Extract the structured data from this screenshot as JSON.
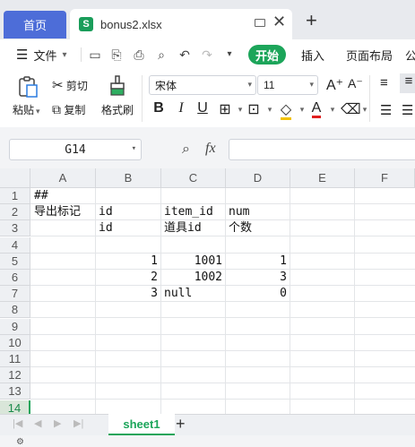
{
  "titlebar": {
    "home_tab": "首页",
    "file_tab": "bonus2.xlsx",
    "file_icon": "S",
    "new_tab": "+"
  },
  "menubar": {
    "file_menu": "文件",
    "start_tab": "开始",
    "insert_tab": "插入",
    "layout_tab": "页面布局",
    "more_tab": "公"
  },
  "ribbon": {
    "paste": "粘贴",
    "cut": "剪切",
    "copy": "复制",
    "format_painter": "格式刷",
    "font_name": "宋体",
    "font_size": "11"
  },
  "formula": {
    "cell_ref": "G14",
    "fx": "fx",
    "content": ""
  },
  "columns": [
    "A",
    "B",
    "C",
    "D",
    "E",
    "F"
  ],
  "rows": [
    "1",
    "2",
    "3",
    "4",
    "5",
    "6",
    "7",
    "8",
    "9",
    "10",
    "11",
    "12",
    "13",
    "14"
  ],
  "selected_row": "14",
  "cells": {
    "A1": "##",
    "A2": "导出标记",
    "B2": "id",
    "C2": "item_id",
    "D2": "num",
    "B3": "id",
    "C3": "道具id",
    "D3": "个数",
    "B5": "1",
    "C5": "1001",
    "D5": "1",
    "B6": "2",
    "C6": "1002",
    "D6": "3",
    "B7": "3",
    "C7": "null",
    "D7": "0"
  },
  "sheets": [
    "sheet1"
  ],
  "add_sheet": "+"
}
